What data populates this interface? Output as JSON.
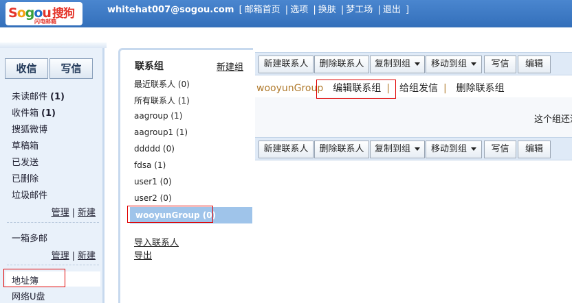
{
  "header": {
    "logo_text": "Sogou搜狗",
    "logo_sub": "闪电邮箱",
    "email": "whitehat007@sogou.com",
    "links": [
      "邮箱首页",
      "选项",
      "换肤",
      "梦工场",
      "退出"
    ]
  },
  "sidebar": {
    "receive_label": "收信",
    "compose_label": "写信",
    "folders": [
      {
        "label": "未读邮件",
        "count": "(1)"
      },
      {
        "label": "收件箱",
        "count": "(1)"
      },
      {
        "label": "搜狐微博",
        "count": ""
      },
      {
        "label": "草稿箱",
        "count": ""
      },
      {
        "label": "已发送",
        "count": ""
      },
      {
        "label": "已删除",
        "count": ""
      },
      {
        "label": "垃圾邮件",
        "count": ""
      }
    ],
    "manage_label": "管理",
    "new_label": "新建",
    "multi_box_label": "一箱多邮",
    "address_book_label": "地址簿",
    "netdisk_label": "网络U盘"
  },
  "groups": {
    "title": "联系组",
    "new_group_label": "新建组",
    "items": [
      "最近联系人 (0)",
      "所有联系人 (1)",
      "aagroup (1)",
      "aagroup1 (1)",
      "ddddd (0)",
      "fdsa (1)",
      "user1 (0)",
      "user2 (0)"
    ],
    "selected": "wooyunGroup (0)",
    "import_label": "导入联系人",
    "export_label": "导出"
  },
  "toolbar": {
    "new_contact": "新建联系人",
    "delete_contact": "删除联系人",
    "copy_to_group": "复制到组",
    "move_to_group": "移动到组",
    "write_mail": "写信",
    "edit": "编辑"
  },
  "group_actions": {
    "group_name": "wooyunGroup",
    "edit_group": "编辑联系组",
    "send_to_group": "给组发信",
    "delete_group": "删除联系组"
  },
  "empty_message": "这个组还没",
  "colors": {
    "topbar": "#3d7bc6",
    "sidebar_bg": "#e9f1fa",
    "selected_group": "#9fc4ea",
    "group_name": "#b07a2c",
    "highlight_box": "#e00000"
  }
}
